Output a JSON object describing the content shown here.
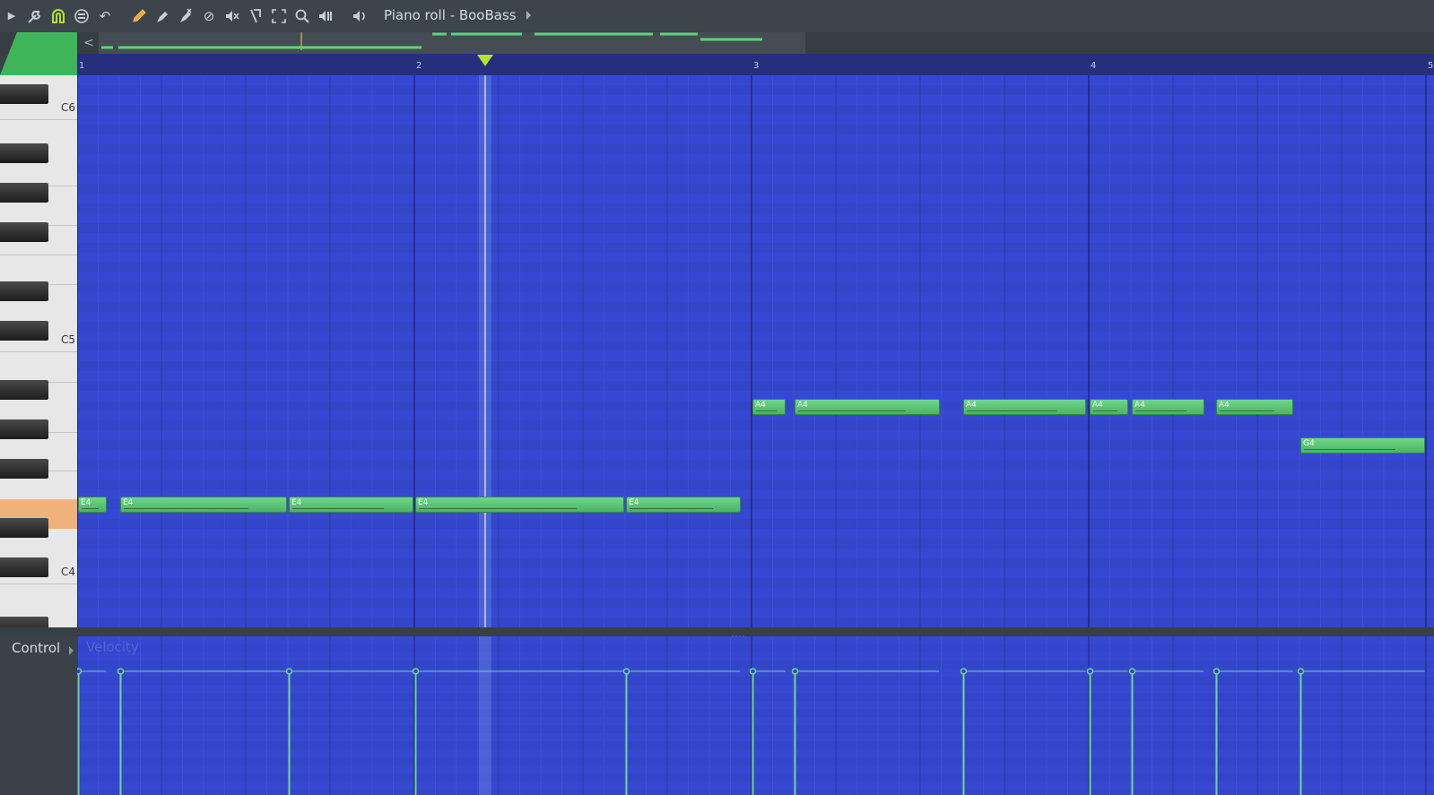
{
  "window": {
    "title": "Piano roll - BooBass"
  },
  "toolbar": {
    "icons": [
      "play-arrow-icon",
      "wrench-icon",
      "magnet-snap-icon",
      "stop-circle-icon",
      "undo-icon",
      "pencil-icon",
      "paint-brush-icon",
      "delete-brush-icon",
      "mute-circle-icon",
      "speaker-mute-icon",
      "slice-icon",
      "select-icon",
      "zoom-icon",
      "playback-icon",
      "volume-icon"
    ]
  },
  "ruler": {
    "bars": [
      "1",
      "2",
      "3",
      "4",
      "5"
    ]
  },
  "keyboard": {
    "octave_labels": [
      "C6",
      "C5",
      "C4"
    ],
    "highlighted_key": "E4"
  },
  "notes": [
    {
      "label": "E4",
      "pitch": "E4",
      "start": 1.0,
      "length": 0.09
    },
    {
      "label": "E4",
      "pitch": "E4",
      "start": 1.125,
      "length": 0.5
    },
    {
      "label": "E4",
      "pitch": "E4",
      "start": 1.625,
      "length": 0.375
    },
    {
      "label": "E4",
      "pitch": "E4",
      "start": 2.0,
      "length": 0.625
    },
    {
      "label": "E4",
      "pitch": "E4",
      "start": 2.625,
      "length": 0.345
    },
    {
      "label": "A4",
      "pitch": "A4",
      "start": 3.0,
      "length": 0.105
    },
    {
      "label": "A4",
      "pitch": "A4",
      "start": 3.125,
      "length": 0.435
    },
    {
      "label": "A4",
      "pitch": "A4",
      "start": 3.625,
      "length": 0.37
    },
    {
      "label": "A4",
      "pitch": "A4",
      "start": 4.0,
      "length": 0.12
    },
    {
      "label": "A4",
      "pitch": "A4",
      "start": 4.125,
      "length": 0.22
    },
    {
      "label": "A4",
      "pitch": "A4",
      "start": 4.375,
      "length": 0.235
    },
    {
      "label": "G4",
      "pitch": "G4",
      "start": 4.625,
      "length": 0.375
    }
  ],
  "playhead_bar": 2.21,
  "control": {
    "label": "Control",
    "parameter": "Velocity",
    "velocity_level": 0.78
  },
  "colors": {
    "grid": "#3446cd",
    "note": "#5cc574",
    "accent": "#b4e32a",
    "highlight_key": "#f0b27a"
  }
}
